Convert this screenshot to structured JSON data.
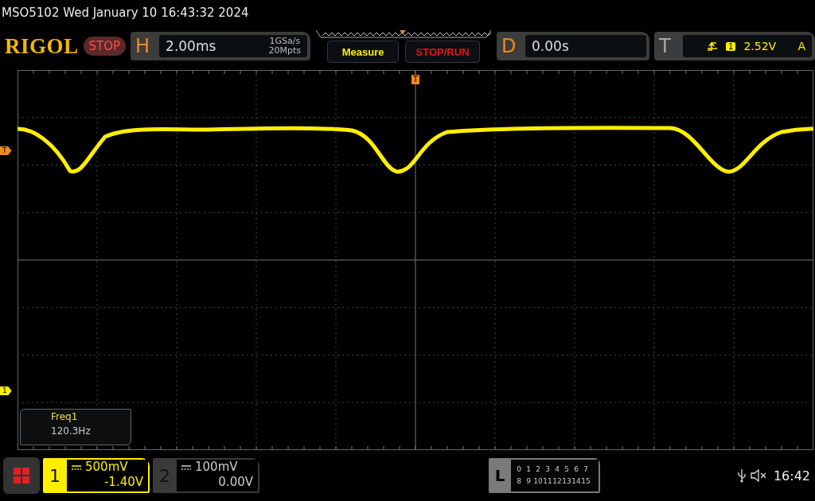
{
  "header": {
    "title": "MSO5102  Wed January 10 16:43:32 2024"
  },
  "toolbar": {
    "logo": "RIGOL",
    "run_state": "STOP",
    "horizontal": {
      "label": "H",
      "timebase": "2.00ms",
      "sample_rate": "1GSa/s",
      "memory_depth": "20Mpts"
    },
    "buttons": [
      "Measure",
      "STOP/RUN"
    ],
    "delay": {
      "label": "D",
      "value": "0.00s"
    },
    "trigger": {
      "label": "T",
      "source": "1",
      "level": "2.52V",
      "mode": "A"
    }
  },
  "grid": {
    "trigger_marker": "T",
    "left_markers": [
      {
        "label": "T",
        "kind": "trigger"
      },
      {
        "label": "1",
        "kind": "channel"
      }
    ]
  },
  "measurement": {
    "name": "Freq1",
    "value": "120.3Hz"
  },
  "channels": [
    {
      "number": "1",
      "scale": "500mV",
      "offset": "-1.40V",
      "on": true
    },
    {
      "number": "2",
      "scale": "100mV",
      "offset": "0.00V",
      "on": false
    }
  ],
  "logic": {
    "label": "L",
    "rows": [
      [
        "0",
        "1",
        "2",
        "3",
        "4",
        "5",
        "6",
        "7"
      ],
      [
        "8",
        "9",
        "10",
        "11",
        "12",
        "13",
        "14",
        "15"
      ]
    ]
  },
  "status": {
    "time": "16:42"
  }
}
